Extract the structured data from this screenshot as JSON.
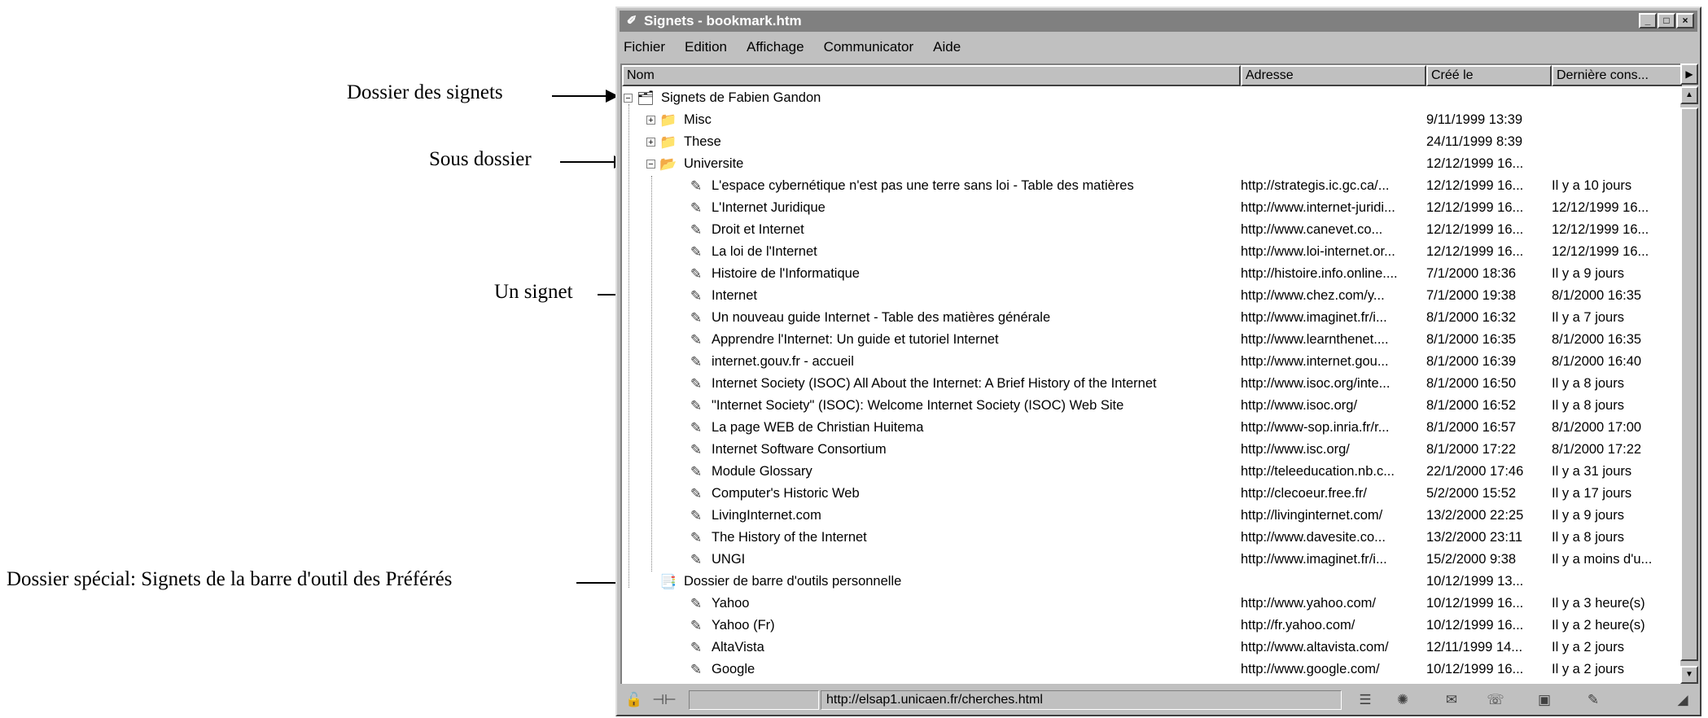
{
  "annotations": [
    {
      "label": "Dossier des signets"
    },
    {
      "label": "Sous dossier"
    },
    {
      "label": "Un signet"
    },
    {
      "label": "Dossier spécial: Signets de la barre d'outil des Préférés"
    }
  ],
  "window": {
    "title": "Signets - bookmark.htm",
    "title_buttons": [
      "_",
      "□",
      "×"
    ]
  },
  "menu": [
    {
      "label": "Fichier"
    },
    {
      "label": "Edition"
    },
    {
      "label": "Affichage"
    },
    {
      "label": "Communicator"
    },
    {
      "label": "Aide"
    }
  ],
  "columns": {
    "nom": "Nom",
    "adresse": "Adresse",
    "cree": "Créé le",
    "derniere": "Dernière cons..."
  },
  "rows": [
    {
      "name": "Signets de Fabien Gandon",
      "addr": "",
      "created": "",
      "last": "",
      "type": "root-folder",
      "expander": "−"
    },
    {
      "name": "Misc",
      "addr": "",
      "created": "9/11/1999 13:39",
      "last": "",
      "type": "folder",
      "expander": "+"
    },
    {
      "name": "These",
      "addr": "",
      "created": "24/11/1999 8:39",
      "last": "",
      "type": "folder",
      "expander": "+"
    },
    {
      "name": "Universite",
      "addr": "",
      "created": "12/12/1999 16...",
      "last": "",
      "type": "folder-open",
      "expander": "−"
    },
    {
      "name": "L'espace cybernétique n'est pas une terre sans loi - Table des matières",
      "addr": "http://strategis.ic.gc.ca/...",
      "created": "12/12/1999 16...",
      "last": "Il y a 10 jours",
      "type": "bookmark"
    },
    {
      "name": "L'Internet Juridique",
      "addr": "http://www.internet-juridi...",
      "created": "12/12/1999 16...",
      "last": "12/12/1999 16...",
      "type": "bookmark"
    },
    {
      "name": "Droit et Internet",
      "addr": "http://www.canevet.co...",
      "created": "12/12/1999 16...",
      "last": "12/12/1999 16...",
      "type": "bookmark"
    },
    {
      "name": "La loi de l'Internet",
      "addr": "http://www.loi-internet.or...",
      "created": "12/12/1999 16...",
      "last": "12/12/1999 16...",
      "type": "bookmark"
    },
    {
      "name": "Histoire de l'Informatique",
      "addr": "http://histoire.info.online....",
      "created": "7/1/2000 18:36",
      "last": "Il y a 9 jours",
      "type": "bookmark"
    },
    {
      "name": "Internet",
      "addr": "http://www.chez.com/y...",
      "created": "7/1/2000 19:38",
      "last": "8/1/2000 16:35",
      "type": "bookmark"
    },
    {
      "name": "Un nouveau guide Internet - Table des matières générale",
      "addr": "http://www.imaginet.fr/i...",
      "created": "8/1/2000 16:32",
      "last": "Il y a 7 jours",
      "type": "bookmark"
    },
    {
      "name": "Apprendre l'Internet: Un guide et tutoriel Internet",
      "addr": "http://www.learnthenet....",
      "created": "8/1/2000 16:35",
      "last": "8/1/2000 16:35",
      "type": "bookmark"
    },
    {
      "name": "internet.gouv.fr - accueil",
      "addr": "http://www.internet.gou...",
      "created": "8/1/2000 16:39",
      "last": "8/1/2000 16:40",
      "type": "bookmark"
    },
    {
      "name": "Internet Society (ISOC) All About the Internet: A Brief History of the Internet",
      "addr": "http://www.isoc.org/inte...",
      "created": "8/1/2000 16:50",
      "last": "Il y a 8 jours",
      "type": "bookmark"
    },
    {
      "name": "\"Internet Society\" (ISOC): Welcome Internet Society (ISOC) Web Site",
      "addr": "http://www.isoc.org/",
      "created": "8/1/2000 16:52",
      "last": "Il y a 8 jours",
      "type": "bookmark"
    },
    {
      "name": "La page WEB de Christian Huitema",
      "addr": "http://www-sop.inria.fr/r...",
      "created": "8/1/2000 16:57",
      "last": "8/1/2000 17:00",
      "type": "bookmark"
    },
    {
      "name": "Internet Software Consortium",
      "addr": "http://www.isc.org/",
      "created": "8/1/2000 17:22",
      "last": "8/1/2000 17:22",
      "type": "bookmark"
    },
    {
      "name": "Module Glossary",
      "addr": "http://teleeducation.nb.c...",
      "created": "22/1/2000 17:46",
      "last": "Il y a 31 jours",
      "type": "bookmark"
    },
    {
      "name": "Computer's Historic Web",
      "addr": "http://clecoeur.free.fr/",
      "created": "5/2/2000 15:52",
      "last": "Il y a 17 jours",
      "type": "bookmark"
    },
    {
      "name": "LivingInternet.com",
      "addr": "http://livinginternet.com/",
      "created": "13/2/2000 22:25",
      "last": "Il y a 9 jours",
      "type": "bookmark"
    },
    {
      "name": "The History of the Internet",
      "addr": "http://www.davesite.co...",
      "created": "13/2/2000 23:11",
      "last": "Il y a 8 jours",
      "type": "bookmark"
    },
    {
      "name": "UNGI",
      "addr": "http://www.imaginet.fr/i...",
      "created": "15/2/2000 9:38",
      "last": "Il y a moins d'u...",
      "type": "bookmark"
    },
    {
      "name": "Dossier de barre d'outils personnelle",
      "addr": "",
      "created": "10/12/1999 13...",
      "last": "",
      "type": "toolbar-folder"
    },
    {
      "name": "Yahoo",
      "addr": "http://www.yahoo.com/",
      "created": "10/12/1999 16...",
      "last": "Il y a 3 heure(s)",
      "type": "bookmark"
    },
    {
      "name": "Yahoo (Fr)",
      "addr": "http://fr.yahoo.com/",
      "created": "10/12/1999 16...",
      "last": "Il y a 2 heure(s)",
      "type": "bookmark"
    },
    {
      "name": "AltaVista",
      "addr": "http://www.altavista.com/",
      "created": "12/11/1999 14...",
      "last": "Il y a 2 jours",
      "type": "bookmark"
    },
    {
      "name": "Google",
      "addr": "http://www.google.com/",
      "created": "10/12/1999 16...",
      "last": "Il y a 2 jours",
      "type": "bookmark"
    }
  ],
  "status": {
    "url": "http://elsap1.unicaen.fr/cherches.html"
  }
}
